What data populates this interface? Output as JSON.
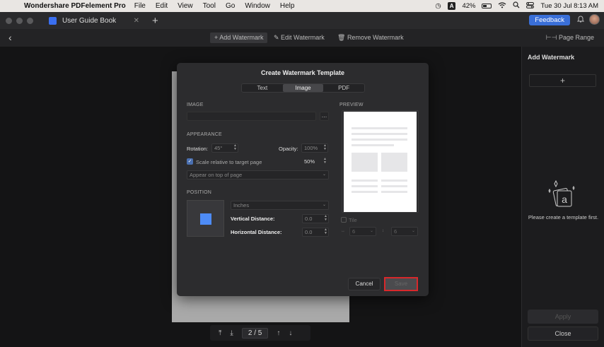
{
  "menubar": {
    "app_name": "Wondershare PDFelement Pro",
    "menus": [
      "File",
      "Edit",
      "View",
      "Tool",
      "Go",
      "Window",
      "Help"
    ],
    "input_source": "A",
    "battery": "42%",
    "datetime": "Tue 30 Jul  8:13 AM"
  },
  "tabbar": {
    "tab_title": "User Guide Book",
    "feedback_label": "Feedback"
  },
  "toolbar": {
    "add_watermark": "Add Watermark",
    "edit_watermark": "Edit Watermark",
    "remove_watermark": "Remove Watermark",
    "page_range": "Page Range"
  },
  "pager": {
    "current_page": "2",
    "separator": "/",
    "total_pages": "5"
  },
  "right_panel": {
    "title": "Add Watermark",
    "empty_text": "Please create a template first.",
    "apply_label": "Apply",
    "close_label": "Close"
  },
  "modal": {
    "title": "Create Watermark Template",
    "tabs": [
      "Text",
      "Image",
      "PDF"
    ],
    "active_tab": "Image",
    "image_label": "IMAGE",
    "preview_label": "PREVIEW",
    "appearance_label": "APPEARANCE",
    "rotation_label": "Rotation:",
    "rotation_value": "45°",
    "opacity_label": "Opacity:",
    "opacity_value": "100%",
    "scale_label": "Scale relative to target page",
    "scale_value": "50%",
    "layer_value": "Appear on top of page",
    "position_label": "POSITION",
    "units_value": "Inches",
    "vertical_label": "Vertical Distance:",
    "vertical_value": "0.0",
    "horizontal_label": "Horizontal Distance:",
    "horizontal_value": "0.0",
    "tile_label": "Tile",
    "tile_x_value": "6",
    "tile_y_value": "6",
    "cancel_label": "Cancel",
    "save_label": "Save"
  }
}
